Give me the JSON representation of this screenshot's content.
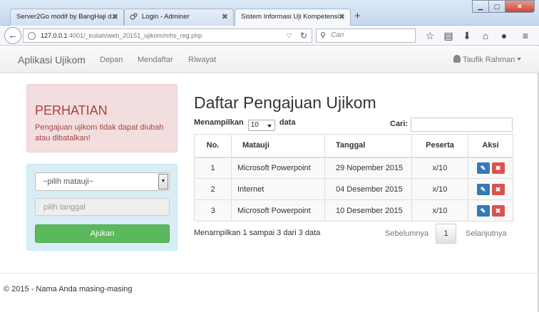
{
  "browser": {
    "tabs": [
      {
        "label": "Server2Go modif by BangHaji d..."
      },
      {
        "label": "Login - Adminer"
      },
      {
        "label": "Sistem Informasi Uji Kompetensi"
      }
    ],
    "url_host": "127.0.0.1",
    "url_rest": ":4001/_kuliah/web_20151_ujikom/mhs_reg.php",
    "search_placeholder": "Cari"
  },
  "navbar": {
    "brand": "Aplikasi Ujikom",
    "links": [
      "Depan",
      "Mendaftar",
      "Riwayat"
    ],
    "user": "Taufik Rahman"
  },
  "alert": {
    "title": "PERHATIAN",
    "message": "Pengajuan ujikom tidak dapat diubah atau dibatalkan!"
  },
  "form": {
    "select_value": "~pilih matauji~",
    "date_placeholder": "pilih tanggal",
    "submit_label": "Ajukan"
  },
  "table": {
    "title": "Daftar Pengajuan Ujikom",
    "length_prefix": "Menampilkan",
    "length_value": "10",
    "length_suffix": "data",
    "filter_label": "Cari:",
    "headers": [
      "No.",
      "Matauji",
      "Tanggal",
      "Peserta",
      "Aksi"
    ],
    "rows": [
      {
        "no": "1",
        "matauji": "Microsoft Powerpoint",
        "tanggal": "29 Nopember 2015",
        "peserta": "x/10"
      },
      {
        "no": "2",
        "matauji": "Internet",
        "tanggal": "04 Desember 2015",
        "peserta": "x/10"
      },
      {
        "no": "3",
        "matauji": "Microsoft Powerpoint",
        "tanggal": "10 Desember 2015",
        "peserta": "x/10"
      }
    ],
    "info": "Menampilkan 1 sampai 3 dari 3 data",
    "prev_label": "Sebelumnya",
    "current_page": "1",
    "next_label": "Selanjutnya"
  },
  "footer": {
    "text": "© 2015 - Nama Anda masing-masing"
  }
}
